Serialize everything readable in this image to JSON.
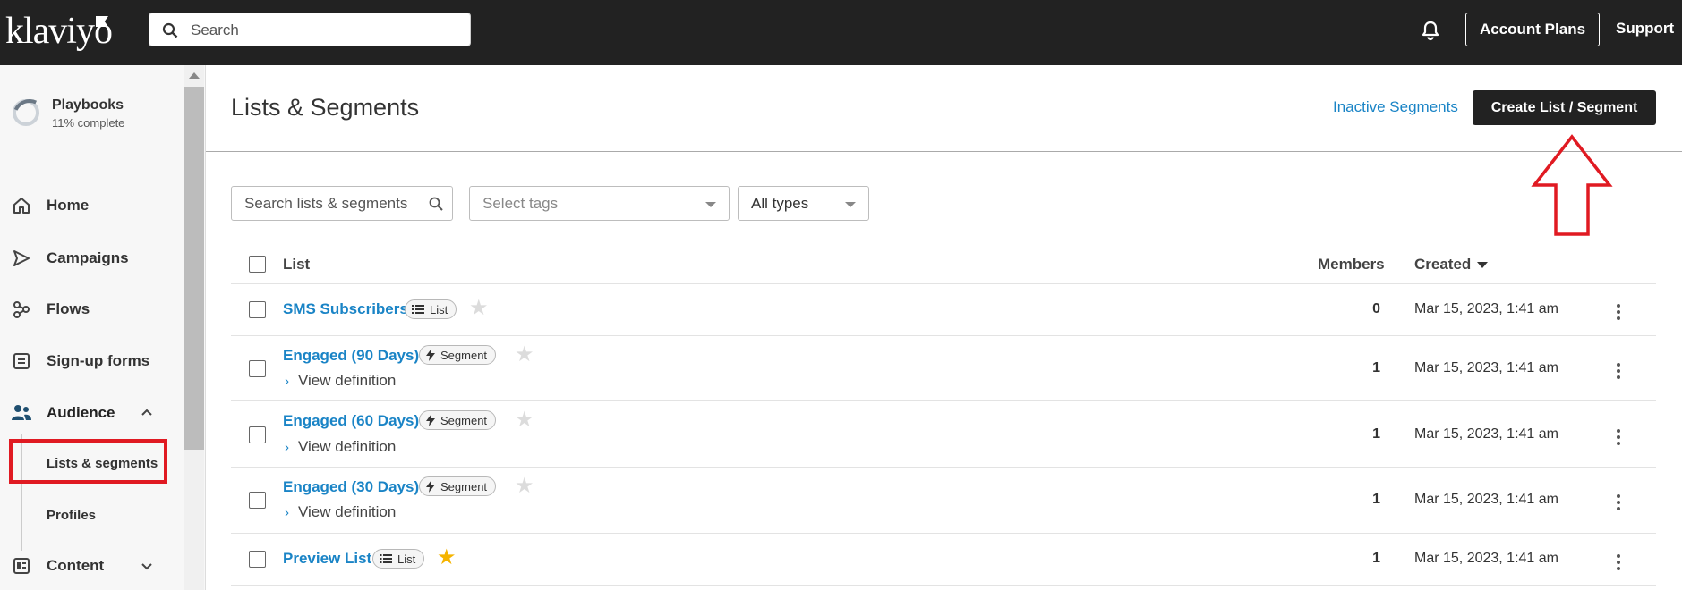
{
  "topbar": {
    "logo_text": "klaviyo",
    "search_placeholder": "Search",
    "account_plans_label": "Account Plans",
    "support_label": "Support",
    "bg_color": "#222222"
  },
  "sidebar": {
    "playbooks": {
      "title": "Playbooks",
      "progress_text": "11% complete",
      "progress": 0.11
    },
    "items": [
      {
        "label": "Home",
        "icon": "home-icon"
      },
      {
        "label": "Campaigns",
        "icon": "send-icon"
      },
      {
        "label": "Flows",
        "icon": "flows-icon"
      },
      {
        "label": "Sign-up forms",
        "icon": "form-icon"
      },
      {
        "label": "Audience",
        "icon": "users-icon"
      },
      {
        "label": "Content",
        "icon": "content-icon"
      }
    ],
    "audience_sub": [
      {
        "label": "Lists & segments",
        "active": true
      },
      {
        "label": "Profiles",
        "active": false
      }
    ]
  },
  "main": {
    "title": "Lists & Segments",
    "inactive_link": "Inactive Segments",
    "create_button": "Create List / Segment",
    "filters": {
      "search_placeholder": "Search lists & segments",
      "tags_placeholder": "Select tags",
      "type_value": "All types"
    },
    "table": {
      "headers": {
        "list": "List",
        "members": "Members",
        "created": "Created"
      },
      "rows": [
        {
          "name": "SMS Subscribers",
          "type": "List",
          "starred": false,
          "view_definition": "",
          "members": "0",
          "created": "Mar 15, 2023, 1:41 am"
        },
        {
          "name": "Engaged (90 Days)",
          "type": "Segment",
          "starred": false,
          "view_definition": "View definition",
          "members": "1",
          "created": "Mar 15, 2023, 1:41 am"
        },
        {
          "name": "Engaged (60 Days)",
          "type": "Segment",
          "starred": false,
          "view_definition": "View definition",
          "members": "1",
          "created": "Mar 15, 2023, 1:41 am"
        },
        {
          "name": "Engaged (30 Days)",
          "type": "Segment",
          "starred": false,
          "view_definition": "View definition",
          "members": "1",
          "created": "Mar 15, 2023, 1:41 am"
        },
        {
          "name": "Preview List",
          "type": "List",
          "starred": true,
          "view_definition": "",
          "members": "1",
          "created": "Mar 15, 2023, 1:41 am"
        }
      ]
    }
  },
  "colors": {
    "link": "#1a84c6",
    "annotation_red": "#e01a22",
    "star_active": "#f5b400",
    "star_inactive": "#dcdcdc"
  }
}
